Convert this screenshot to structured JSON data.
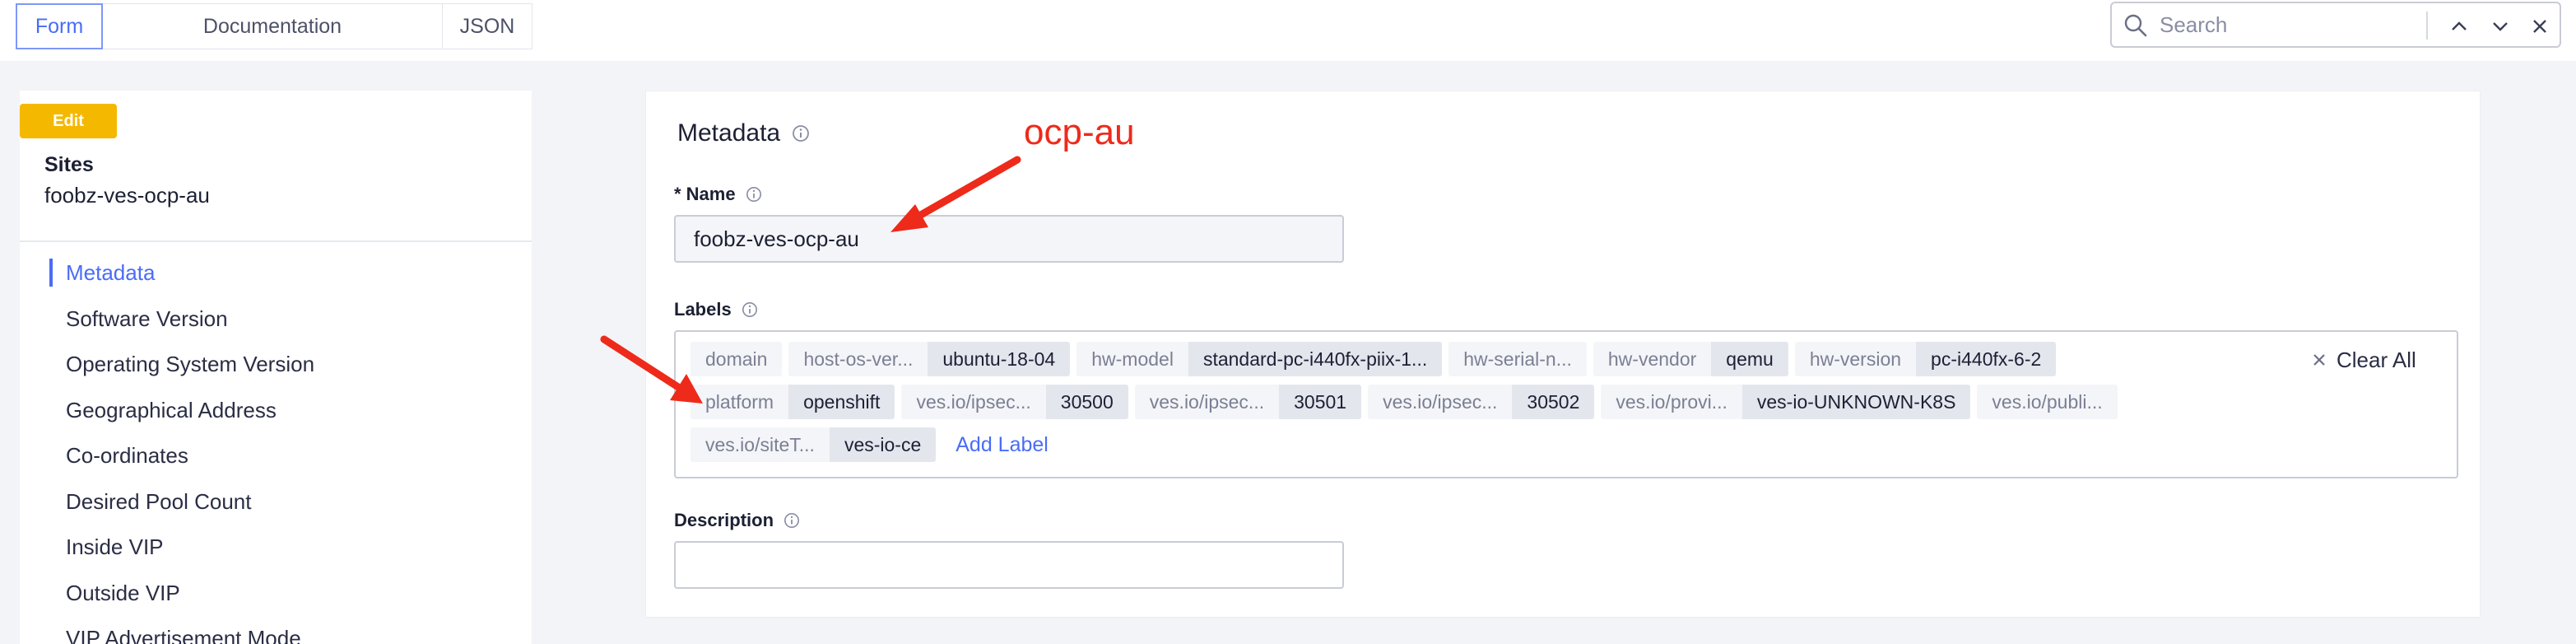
{
  "tabs": [
    {
      "label": "Form",
      "active": true
    },
    {
      "label": "Documentation",
      "active": false
    },
    {
      "label": "JSON",
      "active": false
    }
  ],
  "search": {
    "placeholder": "Search",
    "value": ""
  },
  "sidebar": {
    "badge": "Edit",
    "title": "Sites",
    "name": "foobz-ves-ocp-au",
    "items": [
      {
        "label": "Metadata",
        "active": true
      },
      {
        "label": "Software Version"
      },
      {
        "label": "Operating System Version"
      },
      {
        "label": "Geographical Address"
      },
      {
        "label": "Co-ordinates"
      },
      {
        "label": "Desired Pool Count"
      },
      {
        "label": "Inside VIP"
      },
      {
        "label": "Outside VIP"
      },
      {
        "label": "VIP Advertisement Mode"
      }
    ]
  },
  "main": {
    "section_title": "Metadata",
    "name_label": "* Name",
    "name_value": "foobz-ves-ocp-au",
    "labels_label": "Labels",
    "labels": [
      [
        {
          "key": "domain",
          "value": ""
        },
        {
          "key": "host-os-ver...",
          "value": "ubuntu-18-04"
        },
        {
          "key": "hw-model",
          "value": "standard-pc-i440fx-piix-1..."
        },
        {
          "key": "hw-serial-n...",
          "value": ""
        },
        {
          "key": "hw-vendor",
          "value": "qemu"
        },
        {
          "key": "hw-version",
          "value": "pc-i440fx-6-2"
        }
      ],
      [
        {
          "key": "platform",
          "value": "openshift"
        },
        {
          "key": "ves.io/ipsec...",
          "value": "30500"
        },
        {
          "key": "ves.io/ipsec...",
          "value": "30501"
        },
        {
          "key": "ves.io/ipsec...",
          "value": "30502"
        },
        {
          "key": "ves.io/provi...",
          "value": "ves-io-UNKNOWN-K8S"
        },
        {
          "key": "ves.io/publi...",
          "value": ""
        }
      ],
      [
        {
          "key": "ves.io/siteT...",
          "value": "ves-io-ce"
        }
      ]
    ],
    "add_label": "Add Label",
    "clear_all": "Clear All",
    "description_label": "Description",
    "description_value": ""
  },
  "annotation": {
    "text": "ocp-au",
    "color": "#ee2a1a"
  },
  "colors": {
    "accent": "#4a6cf7",
    "badge": "#f5b800",
    "annotation": "#ee2a1a"
  }
}
